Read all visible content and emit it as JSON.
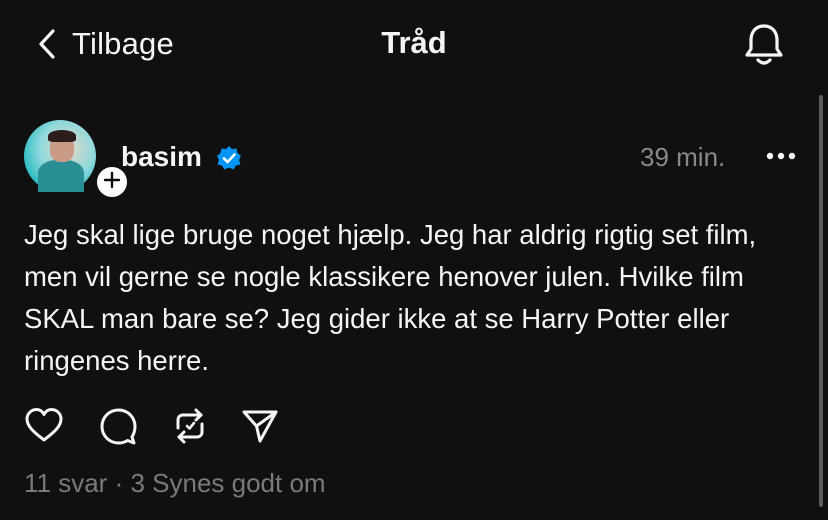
{
  "header": {
    "back_label": "Tilbage",
    "title": "Tråd"
  },
  "post": {
    "username": "basim",
    "verified": true,
    "timestamp": "39 min.",
    "text": "Jeg skal lige bruge noget hjælp. Jeg har aldrig rigtig set film, men vil gerne se nogle klassikere henover julen. Hvilke film SKAL man bare se? Jeg gider ikke at se Harry Potter eller ringenes herre.",
    "replies": "11 svar",
    "separator": " · ",
    "likes": "3 Synes godt om"
  },
  "icons": {
    "back": "chevron-left-icon",
    "bell": "bell-icon",
    "verified": "verified-badge-icon",
    "more": "more-horizontal-icon",
    "follow": "plus-icon",
    "like": "heart-icon",
    "reply": "comment-icon",
    "repost": "repost-icon",
    "share": "send-icon"
  },
  "colors": {
    "background": "#101010",
    "text": "#f3f5f7",
    "muted": "#7a7a7a",
    "verified": "#0095f6"
  }
}
